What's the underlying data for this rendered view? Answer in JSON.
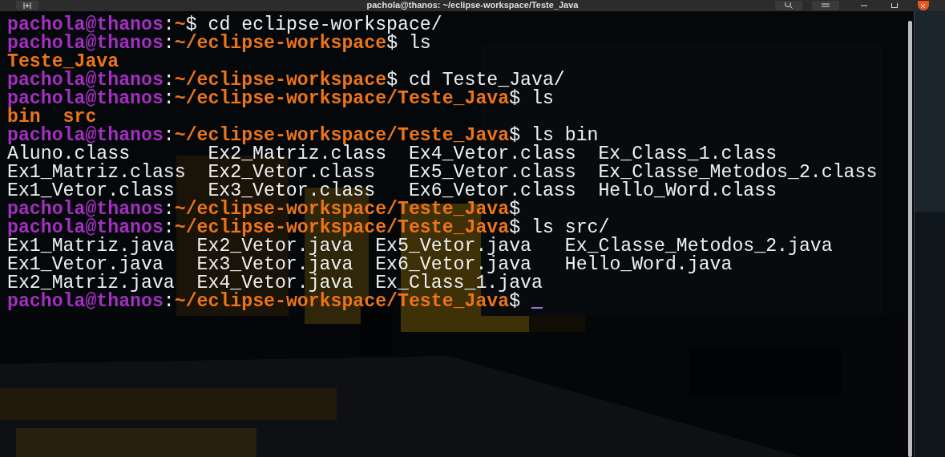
{
  "window": {
    "title": "pachola@thanos: ~/eclipse-workspace/Teste_Java"
  },
  "terminal": {
    "lines": [
      {
        "kind": "prompt",
        "user": "pachola@thanos",
        "separator": ":",
        "path": "~",
        "symbol": "$",
        "command": "cd eclipse-workspace/"
      },
      {
        "kind": "prompt",
        "user": "pachola@thanos",
        "separator": ":",
        "path": "~/eclipse-workspace",
        "symbol": "$",
        "command": "ls"
      },
      {
        "kind": "listing",
        "rows": [
          [
            {
              "name": "Teste_Java",
              "kind": "dir"
            }
          ]
        ]
      },
      {
        "kind": "prompt",
        "user": "pachola@thanos",
        "separator": ":",
        "path": "~/eclipse-workspace",
        "symbol": "$",
        "command": "cd Teste_Java/"
      },
      {
        "kind": "prompt",
        "user": "pachola@thanos",
        "separator": ":",
        "path": "~/eclipse-workspace/Teste_Java",
        "symbol": "$",
        "command": "ls"
      },
      {
        "kind": "listing",
        "rows": [
          [
            {
              "name": "bin",
              "kind": "dir"
            },
            {
              "name": "src",
              "kind": "dir"
            }
          ]
        ]
      },
      {
        "kind": "prompt",
        "user": "pachola@thanos",
        "separator": ":",
        "path": "~/eclipse-workspace/Teste_Java",
        "symbol": "$",
        "command": "ls bin"
      },
      {
        "kind": "listing",
        "rows": [
          [
            {
              "name": "Aluno.class",
              "kind": "file"
            },
            {
              "name": "Ex2_Matriz.class",
              "kind": "file"
            },
            {
              "name": "Ex4_Vetor.class",
              "kind": "file"
            },
            {
              "name": "Ex_Class_1.class",
              "kind": "file"
            }
          ],
          [
            {
              "name": "Ex1_Matriz.class",
              "kind": "file"
            },
            {
              "name": "Ex2_Vetor.class",
              "kind": "file"
            },
            {
              "name": "Ex5_Vetor.class",
              "kind": "file"
            },
            {
              "name": "Ex_Classe_Metodos_2.class",
              "kind": "file"
            }
          ],
          [
            {
              "name": "Ex1_Vetor.class",
              "kind": "file"
            },
            {
              "name": "Ex3_Vetor.class",
              "kind": "file"
            },
            {
              "name": "Ex6_Vetor.class",
              "kind": "file"
            },
            {
              "name": "Hello_Word.class",
              "kind": "file"
            }
          ]
        ]
      },
      {
        "kind": "prompt",
        "user": "pachola@thanos",
        "separator": ":",
        "path": "~/eclipse-workspace/Teste_Java",
        "symbol": "$"
      },
      {
        "kind": "prompt",
        "user": "pachola@thanos",
        "separator": ":",
        "path": "~/eclipse-workspace/Teste_Java",
        "symbol": "$",
        "command": "ls src/"
      },
      {
        "kind": "listing",
        "rows": [
          [
            {
              "name": "Ex1_Matriz.java",
              "kind": "file"
            },
            {
              "name": "Ex2_Vetor.java",
              "kind": "file"
            },
            {
              "name": "Ex5_Vetor.java",
              "kind": "file"
            },
            {
              "name": "Ex_Classe_Metodos_2.java",
              "kind": "file"
            }
          ],
          [
            {
              "name": "Ex1_Vetor.java",
              "kind": "file"
            },
            {
              "name": "Ex3_Vetor.java",
              "kind": "file"
            },
            {
              "name": "Ex6_Vetor.java",
              "kind": "file"
            },
            {
              "name": "Hello_Word.java",
              "kind": "file"
            }
          ],
          [
            {
              "name": "Ex2_Matriz.java",
              "kind": "file"
            },
            {
              "name": "Ex4_Vetor.java",
              "kind": "file"
            },
            {
              "name": "Ex_Class_1.java",
              "kind": "file"
            }
          ]
        ]
      },
      {
        "kind": "prompt",
        "user": "pachola@thanos",
        "separator": ":",
        "path": "~/eclipse-workspace/Teste_Java",
        "symbol": "$",
        "cursor": true
      }
    ]
  }
}
